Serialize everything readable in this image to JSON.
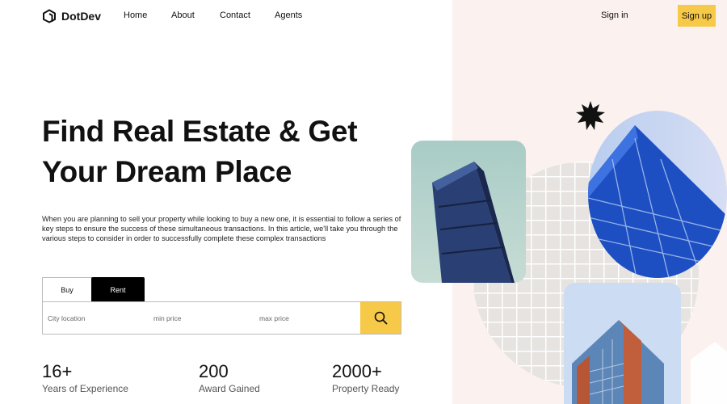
{
  "nav": {
    "logo_text": "DotDev",
    "links": [
      "Home",
      "About",
      "Contact",
      "Agents"
    ],
    "signin_label": "Sign in",
    "signup_label": "Sign up"
  },
  "hero": {
    "headline_line1": "Find Real Estate & Get",
    "headline_line2": "Your Dream Place",
    "description": "When you are planning to sell your property while looking to buy a new one, it is essential to follow a series of key steps to ensure the success of these simultaneous transactions. In this article, we'll take you through the various steps to consider in order to successfully complete these complex transactions"
  },
  "search": {
    "tabs": [
      "Buy",
      "Rent"
    ],
    "active_tab": "Rent",
    "location_placeholder": "City location",
    "min_price_placeholder": "min price",
    "max_price_placeholder": "max price",
    "button_icon": "search-icon"
  },
  "stats": [
    {
      "value": "16+",
      "label": "Years of Experience"
    },
    {
      "value": "200",
      "label": "Award Gained"
    },
    {
      "value": "2000+",
      "label": "Property Ready"
    }
  ],
  "colors": {
    "accent": "#f7c948",
    "right_panel_bg": "#fbf1ef",
    "text": "#111111"
  }
}
